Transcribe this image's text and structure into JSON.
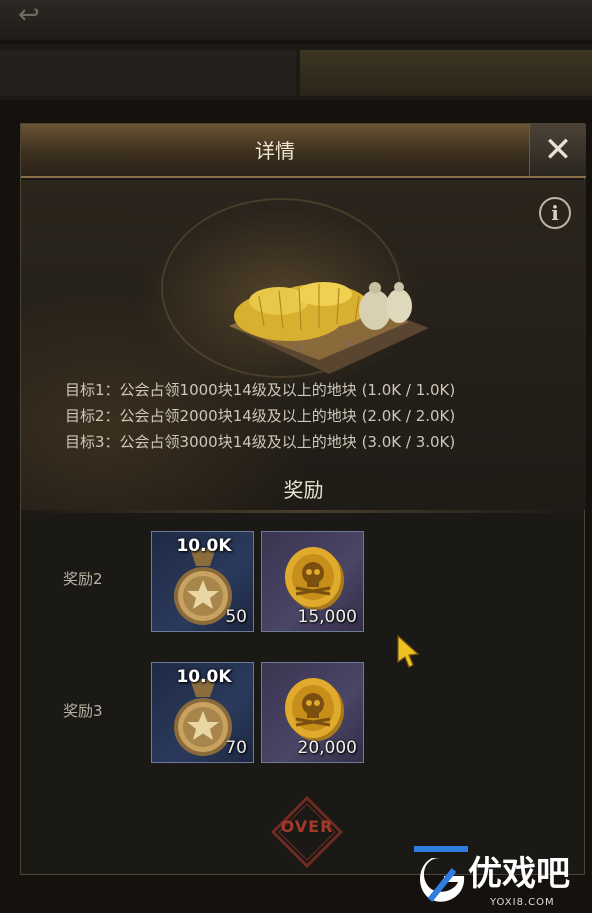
{
  "window": {
    "title": "详情",
    "close_label": "✕",
    "info_label": "i"
  },
  "goals": [
    "目标1：公会占领1000块14级及以上的地块 (1.0K / 1.0K)",
    "目标2：公会占领2000块14级及以上的地块 (2.0K / 2.0K)",
    "目标3：公会占领3000块14级及以上的地块 (3.0K / 3.0K)"
  ],
  "rewards_title": "奖励",
  "rewards": [
    {
      "label": "奖励2",
      "medal": {
        "tag": "10.0K",
        "quantity": "50",
        "icon": "star-medal-icon"
      },
      "coin": {
        "quantity": "15,000",
        "icon": "skull-coin-icon"
      }
    },
    {
      "label": "奖励3",
      "medal": {
        "tag": "10.0K",
        "quantity": "70",
        "icon": "star-medal-icon"
      },
      "coin": {
        "quantity": "20,000",
        "icon": "skull-coin-icon"
      }
    }
  ],
  "status_stamp": "OVER",
  "watermark": {
    "text": "优戏吧",
    "url": "YOXI8.COM"
  },
  "colors": {
    "gold": "#c9a04a",
    "accent_header": "#6b5533",
    "stamp_red": "#a23a2b"
  }
}
